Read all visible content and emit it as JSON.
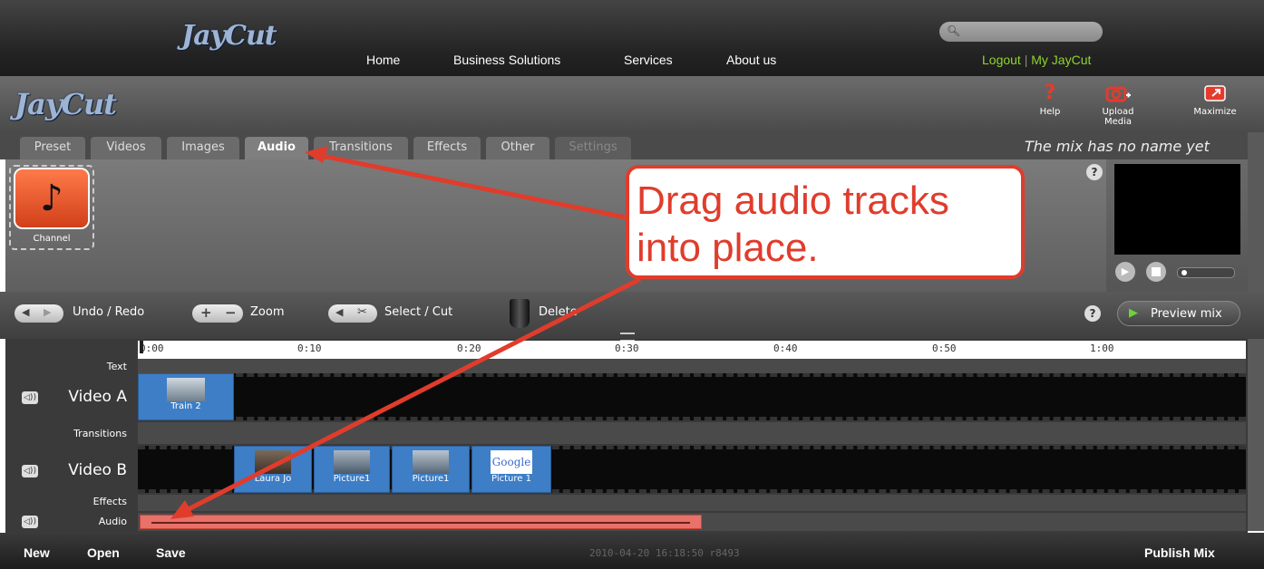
{
  "site": {
    "logo": "JayCut",
    "nav": [
      "Home",
      "Business Solutions",
      "Services",
      "About us"
    ],
    "search_placeholder": "",
    "logout": "Logout",
    "separator": "|",
    "my_jaycut": "My JayCut"
  },
  "app": {
    "logo": "JayCut",
    "header_buttons": [
      {
        "label": "Help",
        "icon": "help-icon"
      },
      {
        "label": "Upload Media",
        "icon": "camera-upload-icon"
      },
      {
        "label": "Maximize",
        "icon": "maximize-icon"
      }
    ],
    "tabs": [
      {
        "label": "Preset",
        "state": "normal"
      },
      {
        "label": "Videos",
        "state": "normal"
      },
      {
        "label": "Images",
        "state": "normal"
      },
      {
        "label": "Audio",
        "state": "active"
      },
      {
        "label": "Transitions",
        "state": "normal"
      },
      {
        "label": "Effects",
        "state": "normal"
      },
      {
        "label": "Other",
        "state": "normal"
      },
      {
        "label": "Settings",
        "state": "disabled"
      }
    ],
    "mix_name": "The mix has no name yet",
    "media_items": [
      {
        "label": "Channel",
        "icon": "music-note-icon"
      }
    ],
    "help_glyph": "?"
  },
  "toolbar": {
    "undo_redo": "Undo / Redo",
    "zoom": "Zoom",
    "zoom_plus": "+",
    "zoom_minus": "−",
    "select_cut": "Select / Cut",
    "delete": "Delete",
    "preview_mix": "Preview mix",
    "help_glyph": "?"
  },
  "timeline": {
    "ruler_ticks": [
      "0:00",
      "0:10",
      "0:20",
      "0:30",
      "0:40",
      "0:50",
      "1:00"
    ],
    "tracks": {
      "text": "Text",
      "video_a": "Video A",
      "transitions": "Transitions",
      "video_b": "Video B",
      "effects": "Effects",
      "audio": "Audio"
    },
    "video_a_clips": [
      {
        "label": "Train 2"
      }
    ],
    "video_b_clips": [
      {
        "label": "Laura Jo"
      },
      {
        "label": "Picture1"
      },
      {
        "label": "Picture1"
      },
      {
        "label": "Picture 1"
      }
    ],
    "google_logo_text": "Google"
  },
  "bottom": {
    "new": "New",
    "open": "Open",
    "save": "Save",
    "build": "2010-04-20 16:18:50 r8493",
    "publish": "Publish Mix"
  },
  "callout": {
    "line1": "Drag audio tracks",
    "line2": "into place."
  },
  "colors": {
    "accent_green": "#8fd42e",
    "callout_red": "#e03c2c",
    "clip_blue": "#3d7ec6",
    "audio_clip_red": "#e8716a"
  }
}
